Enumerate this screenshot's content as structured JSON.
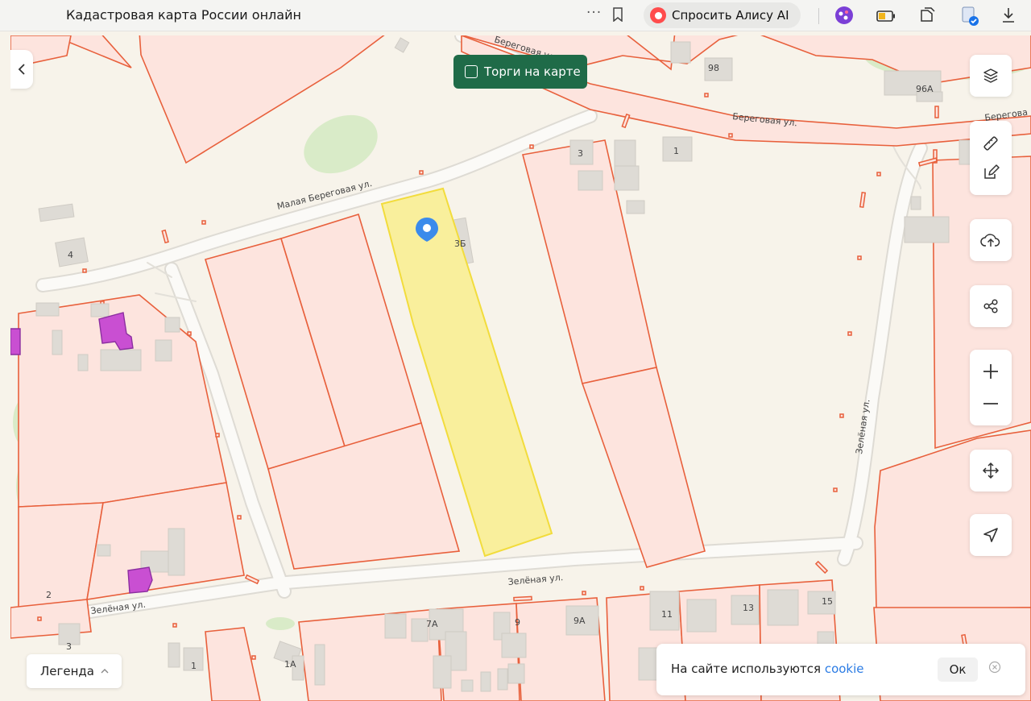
{
  "browser": {
    "title": "Кадастровая карта России онлайн",
    "menu_dots": "···",
    "alice_button": "Спросить Алису AI"
  },
  "map": {
    "torgi_toggle_label": "Торги на карте",
    "street_names": {
      "beregovaya_top": "Береговая ул.",
      "beregovaya_right": "Береговая ул.",
      "beregovaya_right2": "Берегова",
      "malaya_beregovaya": "Малая Береговая ул.",
      "zelenaya_right": "Зелёная ул.",
      "zelenaya_left": "Зелёная ул.",
      "zelenaya_vertical": "Зелёная ул."
    },
    "house_numbers": {
      "h98": "98",
      "h96a": "96А",
      "h3_top": "3",
      "h1_top": "1",
      "h4": "4",
      "h3b": "3Б",
      "h2_left": "2",
      "h3_bottom": "3",
      "h1_bottom": "1",
      "h1a": "1А",
      "h7a": "7А",
      "h9": "9",
      "h9a": "9А",
      "h11": "11",
      "h13": "13",
      "h15": "15"
    }
  },
  "legend": {
    "label": "Легенда"
  },
  "cookie": {
    "text": "На сайте используются ",
    "link": "cookie",
    "ok": "Ок"
  },
  "colors": {
    "parcel_fill": "#fde4de",
    "parcel_stroke": "#e8603c",
    "selected_fill": "#f9ef9c",
    "selected_stroke": "#f2dc3c",
    "marker": "#3b8beb",
    "torgi_bg": "#1f6b48",
    "purple": "#c94fd2",
    "green": "#d5e9c4",
    "building": "#d9d6d1"
  }
}
